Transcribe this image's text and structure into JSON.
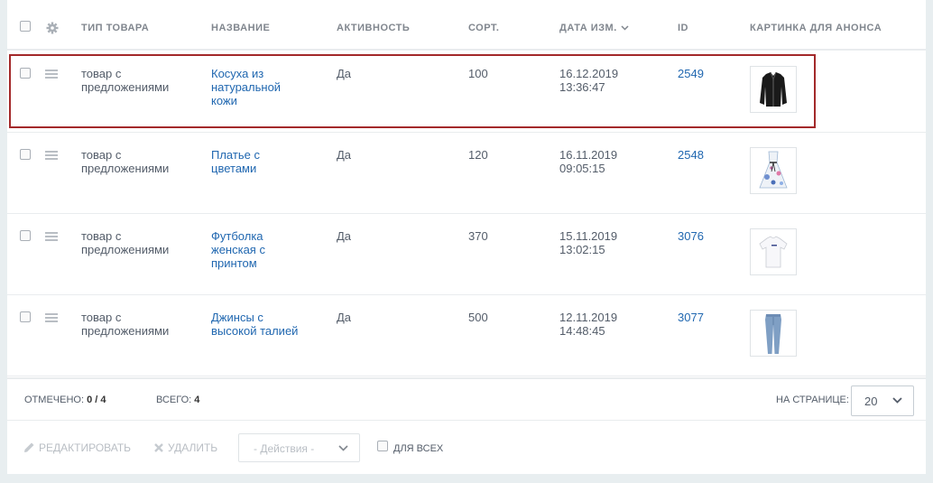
{
  "header": {
    "col_type": "Тип товара",
    "col_name": "Название",
    "col_active": "Активность",
    "col_sort": "Сорт.",
    "col_date": "Дата изм.",
    "col_id": "ID",
    "col_picture": "Картинка для анонса"
  },
  "rows": [
    {
      "type_l1": "товар с",
      "type_l2": "предложениями",
      "name_l1": "Косуха из",
      "name_l2": "натуральной",
      "name_l3": "кожи",
      "active": "Да",
      "sort": "100",
      "date": "16.12.2019",
      "time": "13:36:47",
      "id": "2549",
      "picture": "leather-jacket-thumbnail",
      "selected": true
    },
    {
      "type_l1": "товар с",
      "type_l2": "предложениями",
      "name_l1": "Платье с",
      "name_l2": "цветами",
      "name_l3": "",
      "active": "Да",
      "sort": "120",
      "date": "16.11.2019",
      "time": "09:05:15",
      "id": "2548",
      "picture": "floral-dress-thumbnail",
      "selected": false
    },
    {
      "type_l1": "товар с",
      "type_l2": "предложениями",
      "name_l1": "Футболка",
      "name_l2": "женская с",
      "name_l3": "принтом",
      "active": "Да",
      "sort": "370",
      "date": "15.11.2019",
      "time": "13:02:15",
      "id": "3076",
      "picture": "white-tshirt-thumbnail",
      "selected": false
    },
    {
      "type_l1": "товар с",
      "type_l2": "предложениями",
      "name_l1": "Джинсы с",
      "name_l2": "высокой талией",
      "name_l3": "",
      "active": "Да",
      "sort": "500",
      "date": "12.11.2019",
      "time": "14:48:45",
      "id": "3077",
      "picture": "jeans-thumbnail",
      "selected": false
    }
  ],
  "footer": {
    "checked_label": "Отмечено:",
    "checked_value": "0 / 4",
    "total_label": "Всего:",
    "total_value": "4",
    "per_page_label": "На странице:",
    "per_page_value": "20"
  },
  "actions": {
    "edit": "Редактировать",
    "delete": "Удалить",
    "select": "- Действия -",
    "for_all": "Для всех"
  },
  "colors": {
    "link": "#2067b0",
    "selected_border": "#a3292a"
  }
}
